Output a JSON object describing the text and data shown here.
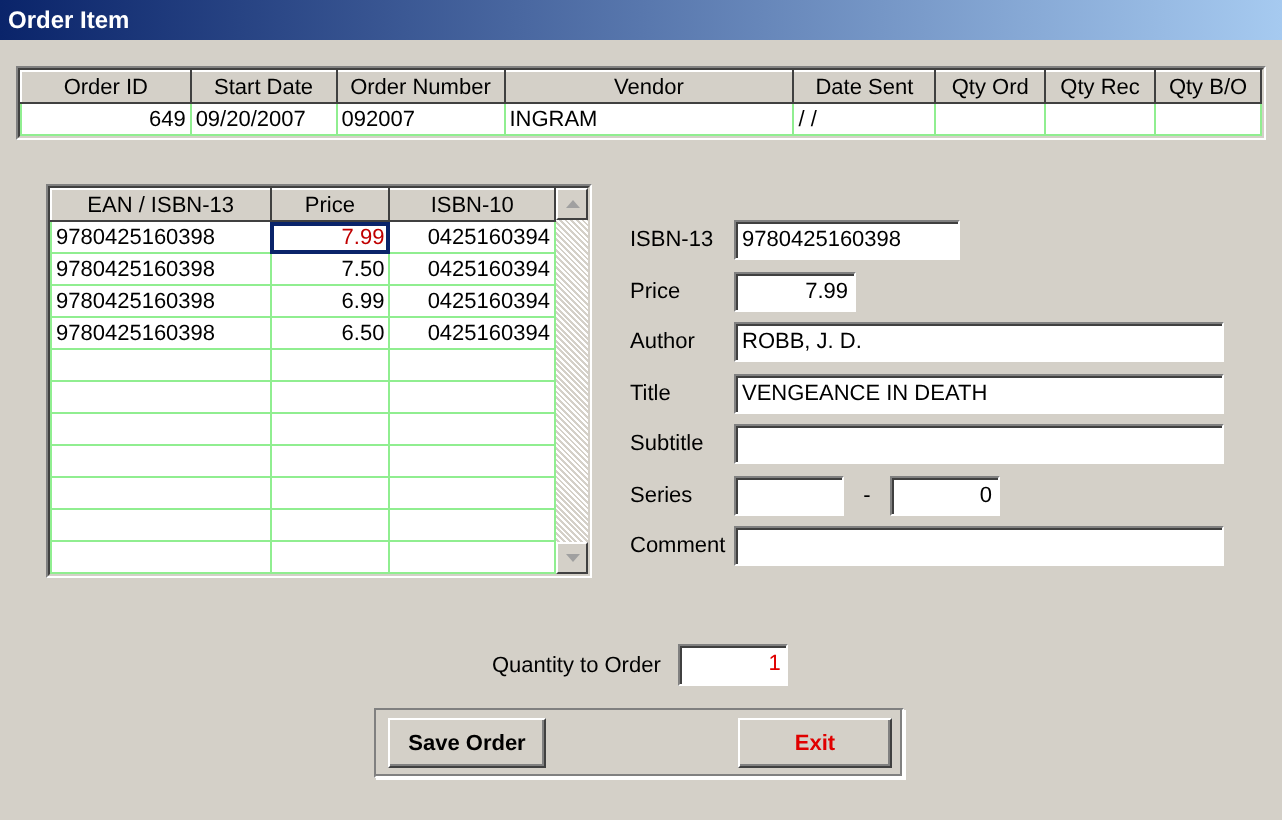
{
  "window": {
    "title": "Order Item"
  },
  "order_table": {
    "columns": [
      "Order ID",
      "Start Date",
      "Order Number",
      "Vendor",
      "Date Sent",
      "Qty Ord",
      "Qty Rec",
      "Qty B/O"
    ],
    "rows": [
      {
        "cells": [
          "649",
          "09/20/2007",
          "092007",
          "INGRAM",
          "/ /"
        ]
      }
    ]
  },
  "items_table": {
    "columns": [
      "EAN / ISBN-13",
      "Price",
      "ISBN-10"
    ],
    "rows": [
      {
        "cells": [
          "9780425160398",
          "7.99",
          "0425160394"
        ],
        "selected": true
      },
      {
        "cells": [
          "9780425160398",
          "7.50",
          "0425160394"
        ],
        "selected": false
      },
      {
        "cells": [
          "9780425160398",
          "6.99",
          "0425160394"
        ],
        "selected": false
      },
      {
        "cells": [
          "9780425160398",
          "6.50",
          "0425160394"
        ],
        "selected": false
      }
    ]
  },
  "form": [
    {
      "label": "ISBN-13",
      "kind": "short",
      "value": "9780425160398"
    },
    {
      "label": "Price",
      "kind": "number",
      "value": "7.99"
    },
    {
      "label": "Author",
      "kind": "wide",
      "value": "ROBB, J. D."
    },
    {
      "label": "Title",
      "kind": "wide",
      "value": "VENGEANCE IN DEATH"
    },
    {
      "label": "Subtitle",
      "kind": "wide"
    },
    {
      "label": "Series",
      "kind": "range",
      "separator": "-",
      "end_value": "0"
    },
    {
      "label": "Comment",
      "kind": "wide"
    }
  ],
  "quantity": {
    "label": "Quantity to Order",
    "value": "1"
  },
  "buttons": [
    {
      "label": "Save Order",
      "kind": "save"
    },
    {
      "label": "Exit",
      "kind": "exit"
    }
  ]
}
